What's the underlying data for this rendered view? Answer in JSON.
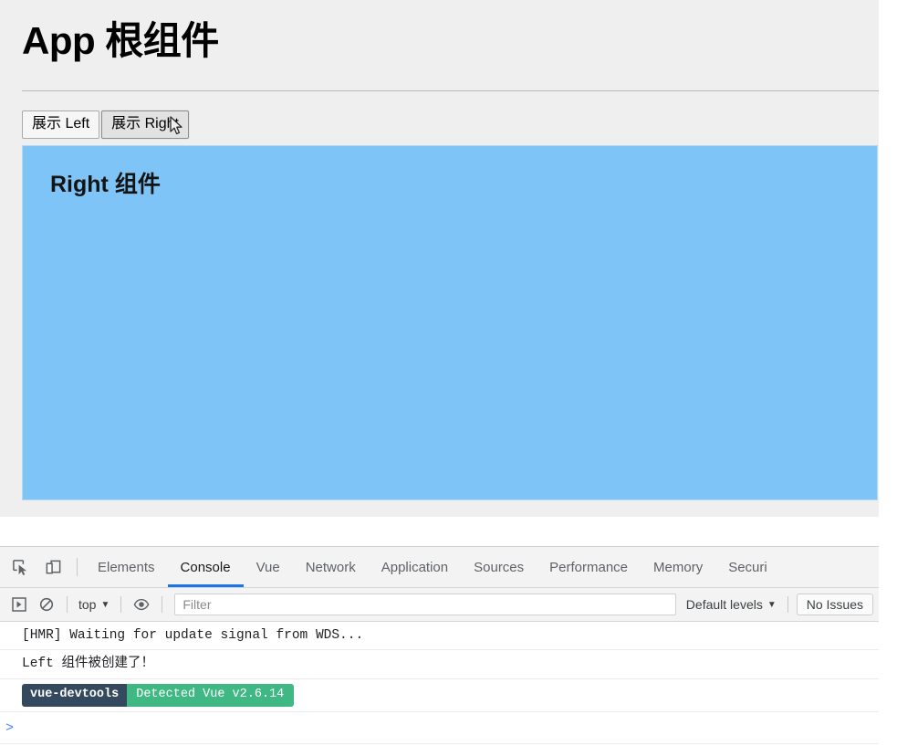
{
  "page": {
    "title": "App 根组件",
    "buttons": [
      {
        "label": "展示 Left",
        "state": "normal"
      },
      {
        "label": "展示 Right",
        "state": "hovered"
      }
    ],
    "panel": {
      "heading": "Right 组件",
      "background_color": "#7ec4f7"
    }
  },
  "devtools": {
    "icons": {
      "inspect": "inspect-element-icon",
      "device": "device-toolbar-icon"
    },
    "tabs": [
      {
        "label": "Elements",
        "active": false
      },
      {
        "label": "Console",
        "active": true
      },
      {
        "label": "Vue",
        "active": false
      },
      {
        "label": "Network",
        "active": false
      },
      {
        "label": "Application",
        "active": false
      },
      {
        "label": "Sources",
        "active": false
      },
      {
        "label": "Performance",
        "active": false
      },
      {
        "label": "Memory",
        "active": false
      },
      {
        "label": "Securi",
        "active": false
      }
    ],
    "active_tab_accent": "#1a73e8",
    "toolbar": {
      "execute_icon": "execute-context-icon",
      "clear_icon": "clear-console-icon",
      "context": "top",
      "context_caret": "▼",
      "eye_icon": "live-expression-eye-icon",
      "filter_placeholder": "Filter",
      "filter_value": "",
      "levels": "Default levels",
      "levels_caret": "▼",
      "issues": "No Issues"
    },
    "console_messages": [
      {
        "text": "[HMR] Waiting for update signal from WDS...",
        "type": "log"
      },
      {
        "text": "Left 组件被创建了！",
        "type": "log"
      }
    ],
    "vue_badge": {
      "left": "vue-devtools",
      "right": "Detected Vue v2.6.14",
      "left_color": "#34495e",
      "right_color": "#3fb883"
    },
    "prompt": ">"
  }
}
